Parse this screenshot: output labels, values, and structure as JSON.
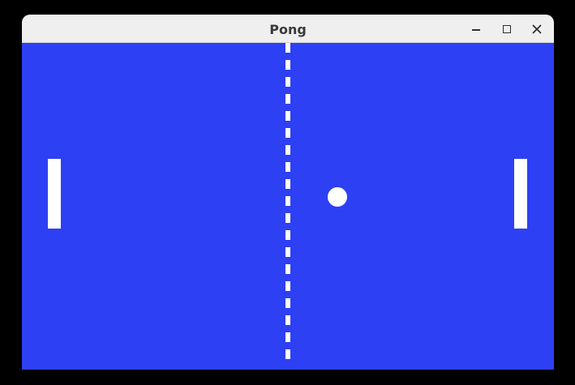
{
  "window": {
    "title": "Pong",
    "controls": {
      "minimize": "minimize-icon",
      "maximize": "maximize-icon",
      "close": "close-icon"
    }
  },
  "game": {
    "background_color": "#2e40f4",
    "foreground_color": "#ffffff",
    "elements": [
      "left-paddle",
      "right-paddle",
      "ball",
      "center-net"
    ]
  }
}
